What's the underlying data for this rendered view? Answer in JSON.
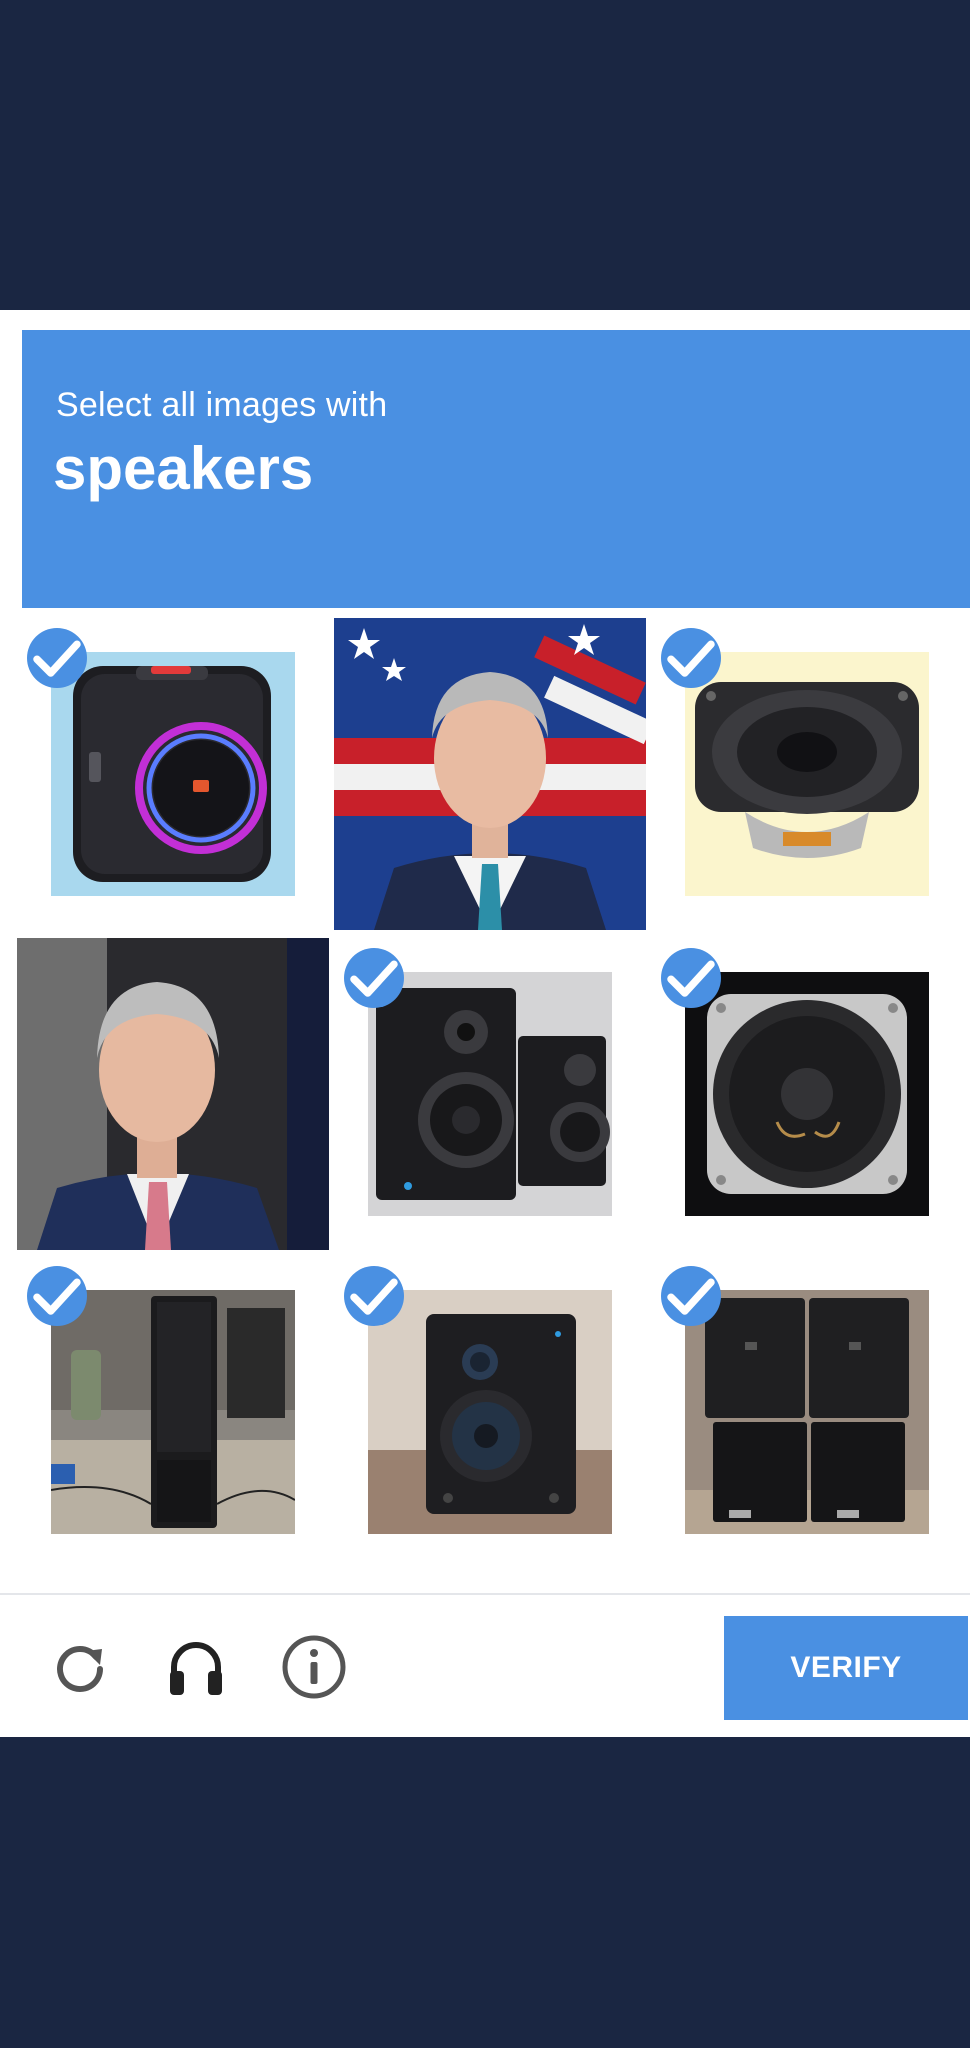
{
  "header": {
    "subtitle": "Select all images with",
    "target": "speakers"
  },
  "grid": {
    "tiles": [
      {
        "name": "tile-1",
        "subject": "portable party speaker",
        "selected": true
      },
      {
        "name": "tile-2",
        "subject": "man in suit with flag",
        "selected": false
      },
      {
        "name": "tile-3",
        "subject": "square speaker driver",
        "selected": true
      },
      {
        "name": "tile-4",
        "subject": "man in suit",
        "selected": false
      },
      {
        "name": "tile-5",
        "subject": "pair of studio monitors",
        "selected": true
      },
      {
        "name": "tile-6",
        "subject": "speaker cone",
        "selected": true
      },
      {
        "name": "tile-7",
        "subject": "column PA speaker",
        "selected": true
      },
      {
        "name": "tile-8",
        "subject": "studio monitor",
        "selected": true
      },
      {
        "name": "tile-9",
        "subject": "stacked PA cabinets",
        "selected": true
      }
    ]
  },
  "footer": {
    "reload_icon": "reload-icon",
    "audio_icon": "headphones-icon",
    "info_icon": "info-icon",
    "verify_label": "VERIFY"
  },
  "colors": {
    "background": "#1a2642",
    "accent": "#4a90e2",
    "panel": "#ffffff"
  }
}
